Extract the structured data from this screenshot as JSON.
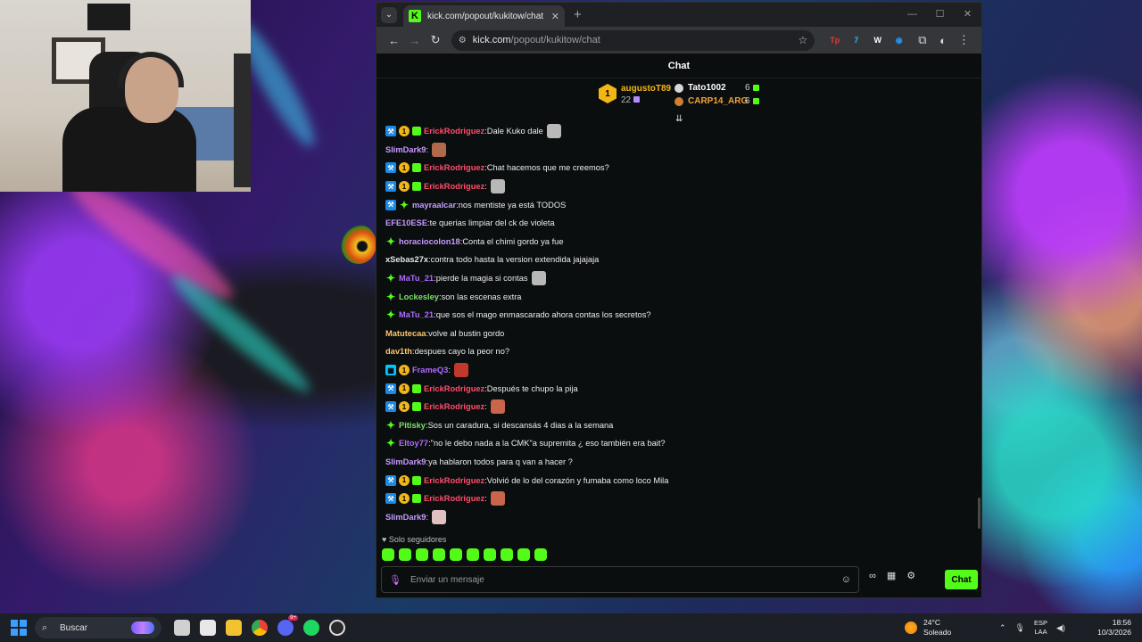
{
  "browser": {
    "tab_title": "kick.com/popout/kukitow/chat",
    "favicon_letter": "K",
    "url_host": "kick.com",
    "url_path": "/popout/kukitow/chat",
    "extensions": [
      {
        "name": "ext-tp",
        "label": "Tp",
        "color": "#e53935"
      },
      {
        "name": "ext-7tv",
        "label": "7",
        "color": "#29b6f6"
      },
      {
        "name": "ext-w",
        "label": "W",
        "color": "#ffffff"
      },
      {
        "name": "ext-shield",
        "label": "◉",
        "color": "#2196f3"
      }
    ]
  },
  "chat": {
    "header_title": "Chat",
    "leaderboard": {
      "first": {
        "rank": "1",
        "name": "augustoT89",
        "count": "22"
      },
      "second": {
        "name": "Tato1002",
        "count": "6"
      },
      "third": {
        "name": "CARP14_ARG",
        "count": "6"
      }
    },
    "messages": [
      {
        "badges": [
          "verified",
          "og",
          "sub"
        ],
        "user": "ErickRodriguez",
        "color": "#ff4d6a",
        "text": "Dale Kuko dale",
        "emote": "#b8b8b8"
      },
      {
        "badges": [],
        "user": "SlimDark9",
        "color": "#c79bff",
        "text": "",
        "emote": "#b06a4a"
      },
      {
        "badges": [
          "verified",
          "og",
          "sub"
        ],
        "user": "ErickRodriguez",
        "color": "#ff4d6a",
        "text": "Chat hacemos que me creemos?",
        "emote": ""
      },
      {
        "badges": [
          "verified",
          "og",
          "sub"
        ],
        "user": "ErickRodriguez",
        "color": "#ff4d6a",
        "text": "",
        "emote": "#b8b8b8"
      },
      {
        "badges": [
          "verified",
          "star"
        ],
        "user": "mayraalcar",
        "color": "#c79bff",
        "text": "nos mentiste ya está TODOS",
        "emote": ""
      },
      {
        "badges": [],
        "user": "EFE10ESE",
        "color": "#c79bff",
        "text": "te querias limpiar del ck de violeta",
        "emote": ""
      },
      {
        "badges": [
          "star"
        ],
        "user": "horaciocolon18",
        "color": "#c79bff",
        "text": "Conta el chimi gordo ya fue",
        "emote": ""
      },
      {
        "badges": [],
        "user": "xSebas27x",
        "color": "#e6e6e6",
        "text": "contra todo hasta la version extendida jajajaja",
        "emote": ""
      },
      {
        "badges": [
          "star"
        ],
        "user": "MaTu_21",
        "color": "#b06aff",
        "text": "pierde la magia si contas",
        "emote": "#b8b8b8"
      },
      {
        "badges": [
          "star"
        ],
        "user": "Lockesley",
        "color": "#7ee06a",
        "text": "son las escenas extra",
        "emote": ""
      },
      {
        "badges": [
          "star"
        ],
        "user": "MaTu_21",
        "color": "#b06aff",
        "text": "que sos el mago enmascarado ahora contas los secretos?",
        "emote": ""
      },
      {
        "badges": [],
        "user": "Matutecaa",
        "color": "#ffc46a",
        "text": "volve al bustin gordo",
        "emote": ""
      },
      {
        "badges": [],
        "user": "dav1th",
        "color": "#ffc46a",
        "text": "despues cayo la peor no?",
        "emote": ""
      },
      {
        "badges": [
          "mod",
          "og"
        ],
        "user": "FrameQ3",
        "color": "#b06aff",
        "text": "",
        "emote": "#c0392b"
      },
      {
        "badges": [
          "verified",
          "og",
          "sub"
        ],
        "user": "ErickRodriguez",
        "color": "#ff4d6a",
        "text": "Después te chupo la pija",
        "emote": ""
      },
      {
        "badges": [
          "verified",
          "og",
          "sub"
        ],
        "user": "ErickRodriguez",
        "color": "#ff4d6a",
        "text": "",
        "emote": "#c8654a"
      },
      {
        "badges": [
          "star"
        ],
        "user": "Pitisky",
        "color": "#7ee06a",
        "text": "Sos un caradura, si descansás 4 dias a la semana",
        "emote": ""
      },
      {
        "badges": [
          "star"
        ],
        "user": "Eltoy77",
        "color": "#b06aff",
        "text": "\"no le debo nada a la CMK\"a supremita ¿ eso también era bait?",
        "emote": ""
      },
      {
        "badges": [],
        "user": "SlimDark9",
        "color": "#c79bff",
        "text": "ya hablaron todos para q van a hacer ?",
        "emote": ""
      },
      {
        "badges": [
          "verified",
          "og",
          "sub"
        ],
        "user": "ErickRodriguez",
        "color": "#ff4d6a",
        "text": "Volvió de lo del corazón y fumaba como loco Mila",
        "emote": ""
      },
      {
        "badges": [
          "verified",
          "og",
          "sub"
        ],
        "user": "ErickRodriguez",
        "color": "#ff4d6a",
        "text": "",
        "emote": "#c8654a"
      },
      {
        "badges": [],
        "user": "SlimDark9",
        "color": "#c79bff",
        "text": "",
        "emote": "#e0c0c0"
      }
    ],
    "followers_only": "Solo seguidores",
    "input_placeholder": "Enviar un mensaje",
    "send_label": "Chat"
  },
  "taskbar": {
    "search_label": "Buscar",
    "discord_badge": "9+",
    "weather_temp": "24°C",
    "weather_desc": "Soleado",
    "lang_line1": "ESP",
    "lang_line2": "LAA",
    "time": "18:56",
    "date": "10/3/2026"
  }
}
